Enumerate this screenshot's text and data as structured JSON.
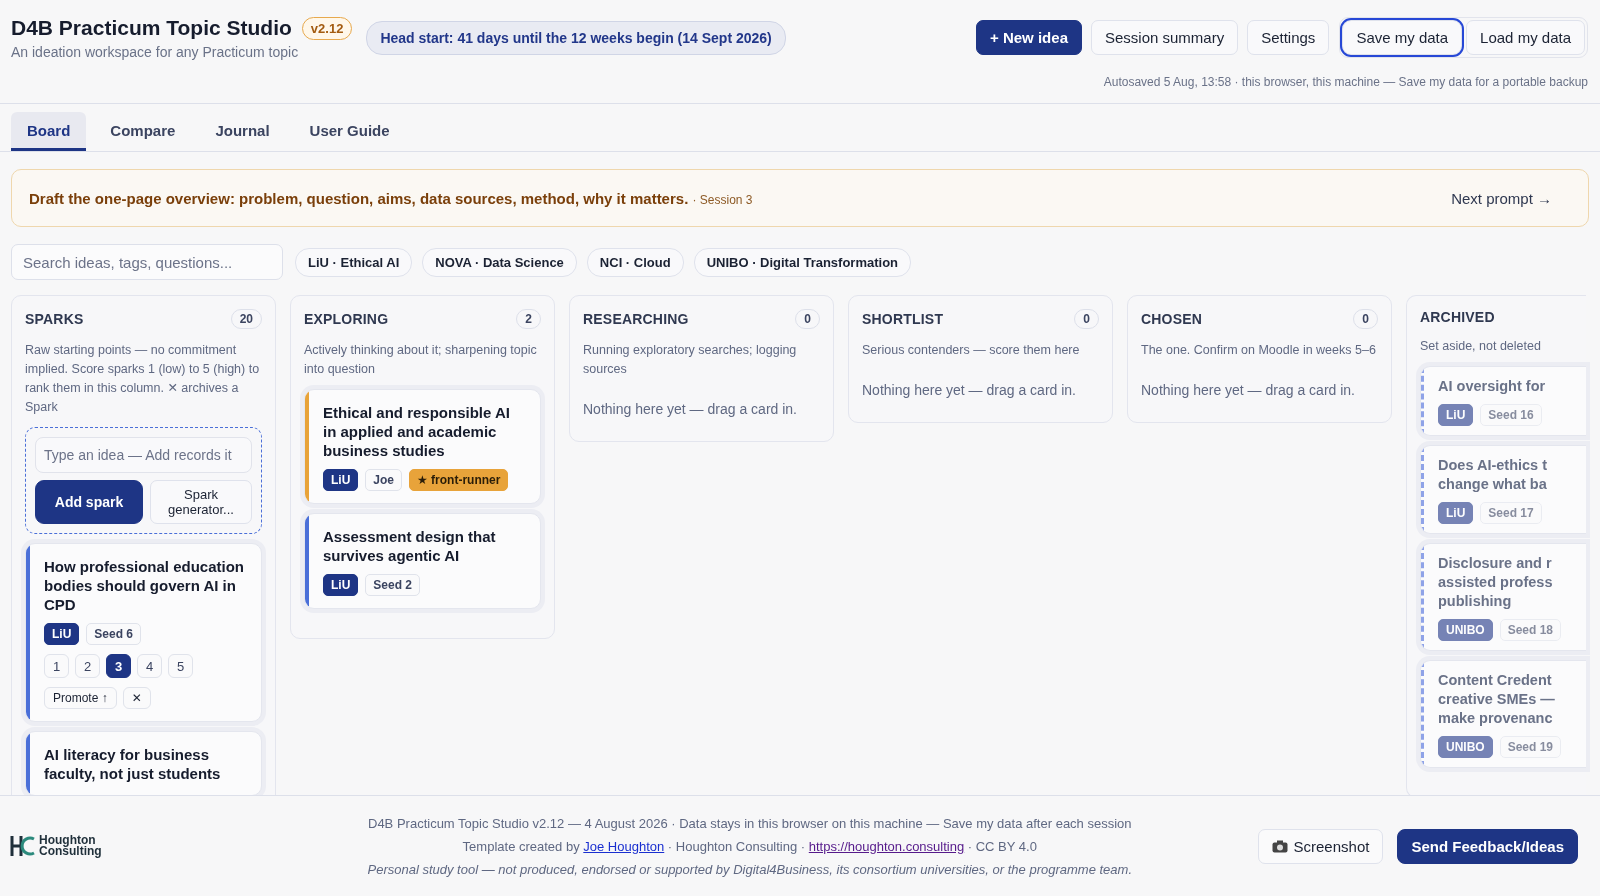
{
  "header": {
    "title": "D4B Practicum Topic Studio",
    "version": "v2.12",
    "subtitle": "An ideation workspace for any Practicum topic",
    "countdown": "Head start: 41 days until the 12 weeks begin (14 Sept 2026)",
    "actions": [
      {
        "label": "+ New idea",
        "kind": "primary"
      },
      {
        "label": "Session summary",
        "kind": "plain"
      },
      {
        "label": "Settings",
        "kind": "plain"
      }
    ],
    "data_actions": [
      {
        "label": "Save my data",
        "focused": true
      },
      {
        "label": "Load my data",
        "focused": false
      }
    ],
    "autosave": "Autosaved 5 Aug, 13:58 · this browser, this machine — Save my data for a portable backup"
  },
  "tabs": [
    {
      "label": "Board",
      "selected": true
    },
    {
      "label": "Compare",
      "selected": false
    },
    {
      "label": "Journal",
      "selected": false
    },
    {
      "label": "User Guide",
      "selected": false
    }
  ],
  "prompt": {
    "text": "Draft the one-page overview: problem, question, aims, data sources, method, why it matters.",
    "session": "· Session 3",
    "next": "Next prompt →"
  },
  "search": {
    "placeholder": "Search ideas, tags, questions..."
  },
  "filters": [
    "LiU · Ethical AI",
    "NOVA · Data Science",
    "NCI · Cloud",
    "UNIBO · Digital Transformation"
  ],
  "columns": [
    {
      "title": "SPARKS",
      "count": "20",
      "kind": "active",
      "description": "Raw starting points — no commitment implied. Score sparks 1 (low) to 5 (high) to rank them in this column. ✕ archives a Spark",
      "composer": {
        "placeholder": "Type an idea — Add records it",
        "add": "Add spark",
        "generator": "Spark generator..."
      },
      "cards": [
        {
          "title": "How professional education bodies should govern AI in CPD",
          "color": "#4a6fd8",
          "tags": [
            {
              "text": "LiU",
              "kind": "uni"
            },
            {
              "text": "Seed 6",
              "kind": "plain"
            }
          ],
          "scores": [
            {
              "label": "1",
              "selected": false
            },
            {
              "label": "2",
              "selected": false
            },
            {
              "label": "3",
              "selected": true
            },
            {
              "label": "4",
              "selected": false
            },
            {
              "label": "5",
              "selected": false
            }
          ],
          "promote": "Promote ↑",
          "archive": "✕"
        },
        {
          "title": "AI literacy for business faculty, not just students",
          "color": "#4a6fd8"
        }
      ]
    },
    {
      "title": "EXPLORING",
      "count": "2",
      "kind": "active",
      "description": "Actively thinking about it; sharpening topic into question",
      "cards": [
        {
          "title": "Ethical and responsible AI in applied and academic business studies",
          "color": "#e8a33a",
          "tags": [
            {
              "text": "LiU",
              "kind": "uni"
            },
            {
              "text": "Joe",
              "kind": "plain"
            },
            {
              "text": "★ front-runner",
              "kind": "star"
            }
          ]
        },
        {
          "title": "Assessment design that survives agentic AI",
          "color": "#4a6fd8",
          "tags": [
            {
              "text": "LiU",
              "kind": "uni"
            },
            {
              "text": "Seed 2",
              "kind": "plain"
            }
          ]
        }
      ]
    },
    {
      "title": "RESEARCHING",
      "count": "0",
      "kind": "active",
      "description": "Running exploratory searches; logging sources",
      "empty": "Nothing here yet — drag a card in."
    },
    {
      "title": "SHORTLIST",
      "count": "0",
      "kind": "active",
      "description": "Serious contenders — score them here",
      "empty": "Nothing here yet — drag a card in."
    },
    {
      "title": "CHOSEN",
      "count": "0",
      "kind": "active",
      "description": "The one. Confirm on Moodle in weeks 5–6",
      "empty": "Nothing here yet — drag a card in."
    },
    {
      "title": "ARCHIVED",
      "kind": "archived",
      "description": "Set aside, not deleted",
      "cards": [
        {
          "title": "AI oversight for",
          "color": "#8fa3e8",
          "tags": [
            {
              "text": "LiU",
              "kind": "uni"
            },
            {
              "text": "Seed 16",
              "kind": "plain"
            }
          ]
        },
        {
          "title": "Does AI-ethics t change what ba",
          "color": "#8fa3e8",
          "tags": [
            {
              "text": "LiU",
              "kind": "uni"
            },
            {
              "text": "Seed 17",
              "kind": "plain"
            }
          ]
        },
        {
          "title": "Disclosure and r assisted profess publishing",
          "color": "#8fa3e8",
          "tags": [
            {
              "text": "UNIBO",
              "kind": "uni"
            },
            {
              "text": "Seed 18",
              "kind": "plain"
            }
          ]
        },
        {
          "title": "Content Credent creative SMEs — make provenanc",
          "color": "#8fa3e8",
          "tags": [
            {
              "text": "UNIBO",
              "kind": "uni"
            },
            {
              "text": "Seed 19",
              "kind": "plain"
            }
          ]
        }
      ]
    }
  ],
  "footer": {
    "logo": [
      "Houghton",
      "Consulting"
    ],
    "line1": "D4B Practicum Topic Studio v2.12 — 4 August 2026 · Data stays in this browser on this machine — Save my data after each session",
    "line2": {
      "before": "Template created by",
      "author": "Joe Houghton",
      "middle": "· Houghton Consulting ·",
      "url": "https://houghton.consulting",
      "after": "· CC BY 4.0"
    },
    "line3": "Personal study tool — not produced, endorsed or supported by Digital4Business, its consortium universities, or the programme team.",
    "screenshot": "Screenshot",
    "feedback": "Send Feedback/Ideas"
  }
}
